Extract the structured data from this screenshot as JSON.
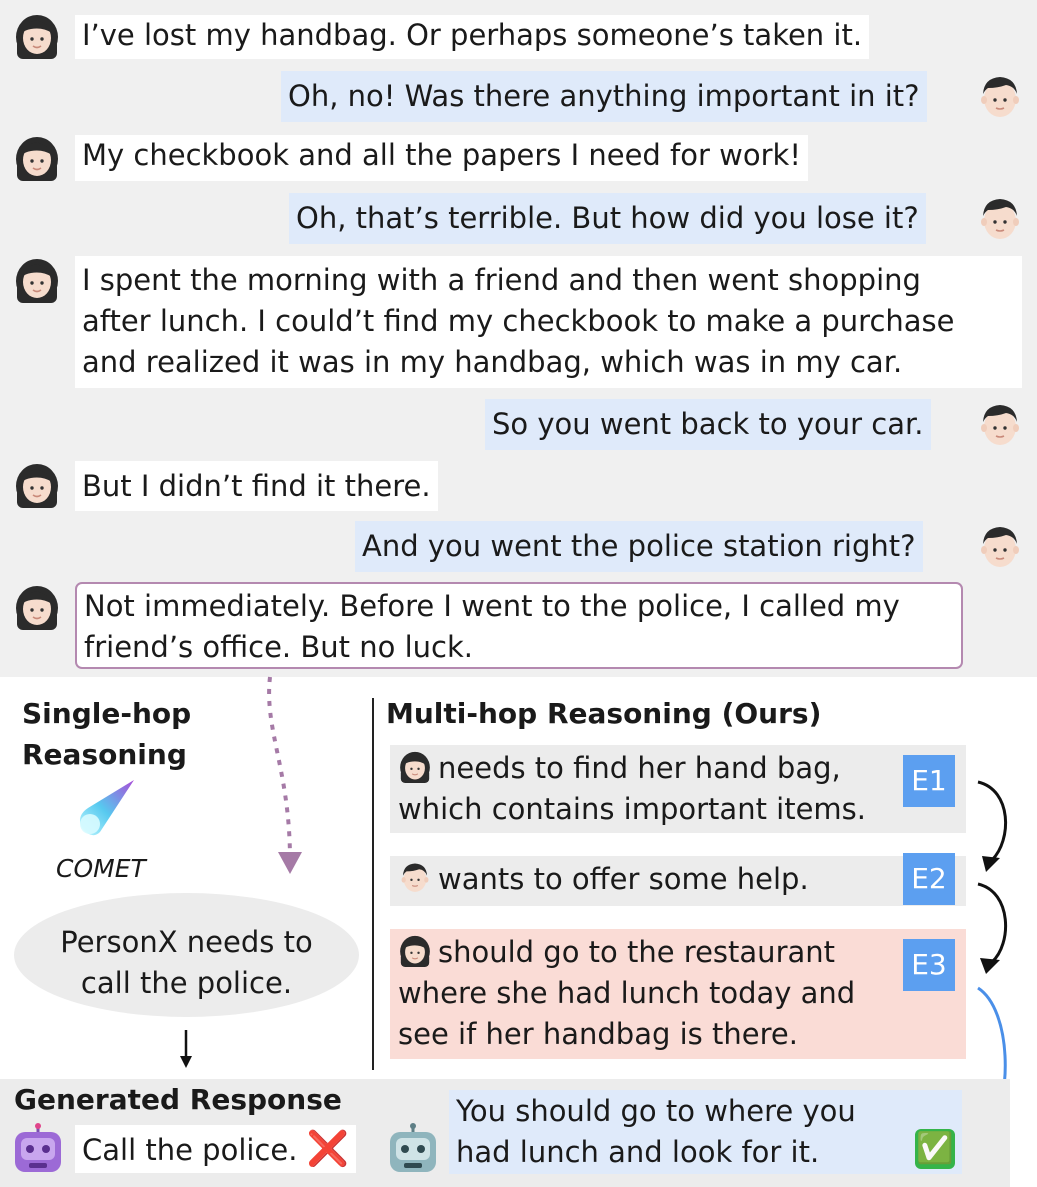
{
  "dialogue": [
    {
      "speaker": "woman",
      "text": "I’ve lost my handbag. Or perhaps someone’s taken it."
    },
    {
      "speaker": "man",
      "text": "Oh, no! Was there anything important in it?"
    },
    {
      "speaker": "woman",
      "text": "My checkbook and all the papers I need for work!"
    },
    {
      "speaker": "man",
      "text": "Oh, that’s terrible. But how did you lose it?"
    },
    {
      "speaker": "woman",
      "lines": [
        "I spent the morning with a friend and then went shopping",
        "after lunch. I could’t find my checkbook to make a purchase",
        "and realized it was in my handbag, which was in my car."
      ]
    },
    {
      "speaker": "man",
      "text": "So you went back to your car."
    },
    {
      "speaker": "woman",
      "text": "But I didn’t find it there."
    },
    {
      "speaker": "man",
      "text": "And you went the police station right?"
    },
    {
      "speaker": "woman",
      "lines": [
        "Not immediately. Before I went to the police, I called my",
        "friend’s office. But no luck."
      ]
    }
  ],
  "single_hop": {
    "heading_lines": [
      "Single-hop",
      "Reasoning"
    ],
    "model_label": "COMET",
    "inference_lines": [
      "PersonX needs to",
      "call the police."
    ]
  },
  "multi_hop": {
    "heading": "Multi-hop Reasoning (Ours)",
    "events": [
      {
        "tag": "E1",
        "lines": [
          "needs to find her hand bag,",
          "which contains important items."
        ],
        "subject": "woman",
        "color": "#ececec"
      },
      {
        "tag": "E2",
        "lines": [
          "wants to offer some help."
        ],
        "subject": "man",
        "color": "#ececec"
      },
      {
        "tag": "E3",
        "lines": [
          "should go to the restaurant",
          "where she had lunch today and",
          "see if her handbag is there."
        ],
        "subject": "woman",
        "color": "#fadcd6"
      }
    ]
  },
  "generated": {
    "heading": "Generated Response",
    "baseline": {
      "text": "Call the police.",
      "mark": "❌",
      "avatar": "robot-face-purple"
    },
    "ours": {
      "lines": [
        "You should go to where you",
        "had lunch and look for it."
      ],
      "mark": "✅",
      "avatar": "robot-face-teal"
    }
  },
  "colors": {
    "panel": "#f0f0f0",
    "man_bubble": "#dfeafa",
    "highlight_border": "#b489b0",
    "event_tag": "#5c9ff0",
    "e3_bg": "#fadcd6",
    "blue_arrow": "#4a8fe8"
  }
}
